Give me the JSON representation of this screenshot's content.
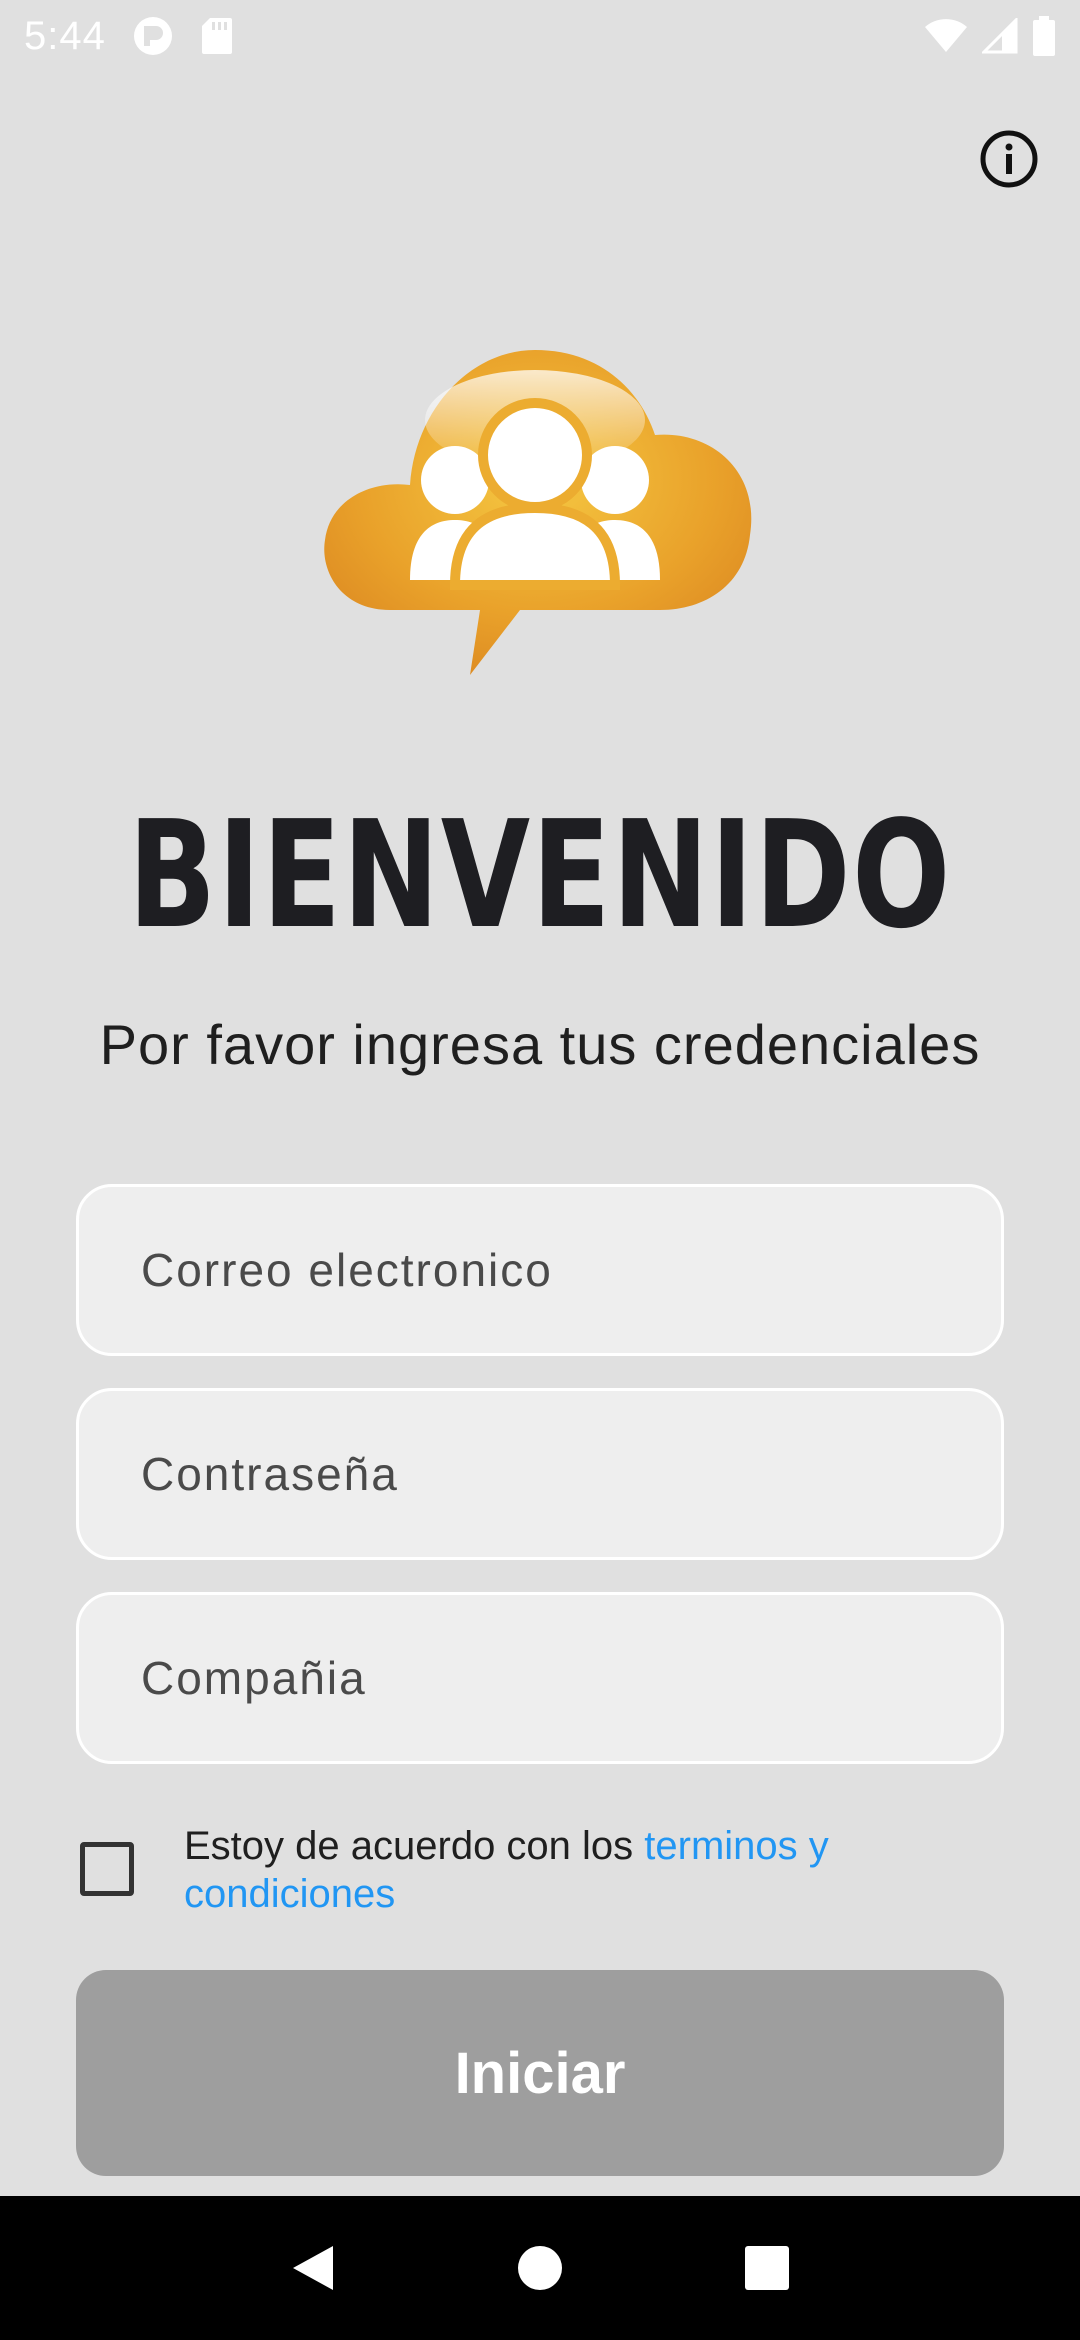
{
  "status_bar": {
    "time": "5:44",
    "icons": [
      "app-icon",
      "sd-card-icon",
      "wifi-icon",
      "signal-icon",
      "battery-icon"
    ]
  },
  "header": {
    "info_icon": "info-icon"
  },
  "welcome": {
    "title": "BIENVENIDO",
    "subtitle": "Por favor ingresa tus credenciales"
  },
  "form": {
    "email_placeholder": "Correo electronico",
    "password_placeholder": "Contraseña",
    "company_placeholder": "Compañia",
    "terms_prefix": "Estoy de acuerdo con los ",
    "terms_link": "terminos y condiciones",
    "terms_checked": false,
    "submit_label": "Iniciar"
  },
  "nav_bar": {
    "buttons": [
      "back-icon",
      "home-icon",
      "recents-icon"
    ]
  },
  "colors": {
    "background": "#e0e0e0",
    "link": "#2196f3",
    "button_disabled": "#9e9e9e",
    "logo_orange": "#e8a020"
  }
}
